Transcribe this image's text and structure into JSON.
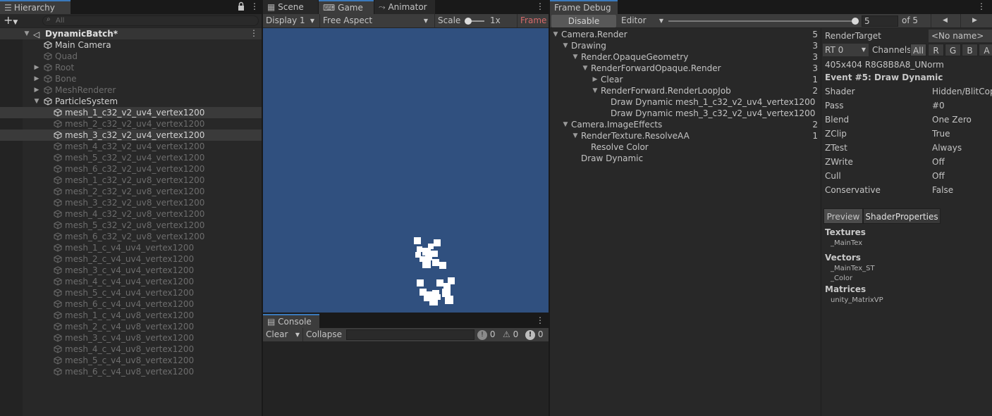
{
  "hierarchy": {
    "tab_label": "Hierarchy",
    "search_placeholder": "All",
    "scene_name": "DynamicBatch*",
    "items": [
      {
        "label": "Main Camera",
        "active": true
      },
      {
        "label": "Quad",
        "active": false
      },
      {
        "label": "Root",
        "active": false
      },
      {
        "label": "Bone",
        "active": false
      },
      {
        "label": "MeshRenderer",
        "active": false
      },
      {
        "label": "ParticleSystem",
        "active": true
      }
    ],
    "children": [
      {
        "label": "mesh_1_c32_v2_uv4_vertex1200",
        "active": true
      },
      {
        "label": "mesh_2_c32_v2_uv4_vertex1200",
        "active": false
      },
      {
        "label": "mesh_3_c32_v2_uv4_vertex1200",
        "active": true
      },
      {
        "label": "mesh_4_c32_v2_uv4_vertex1200",
        "active": false
      },
      {
        "label": "mesh_5_c32_v2_uv4_vertex1200",
        "active": false
      },
      {
        "label": "mesh_6_c32_v2_uv4_vertex1200",
        "active": false
      },
      {
        "label": "mesh_1_c32_v2_uv8_vertex1200",
        "active": false
      },
      {
        "label": "mesh_2_c32_v2_uv8_vertex1200",
        "active": false
      },
      {
        "label": "mesh_3_c32_v2_uv8_vertex1200",
        "active": false
      },
      {
        "label": "mesh_4_c32_v2_uv8_vertex1200",
        "active": false
      },
      {
        "label": "mesh_5_c32_v2_uv8_vertex1200",
        "active": false
      },
      {
        "label": "mesh_6_c32_v2_uv8_vertex1200",
        "active": false
      },
      {
        "label": "mesh_1_c_v4_uv4_vertex1200",
        "active": false
      },
      {
        "label": "mesh_2_c_v4_uv4_vertex1200",
        "active": false
      },
      {
        "label": "mesh_3_c_v4_uv4_vertex1200",
        "active": false
      },
      {
        "label": "mesh_4_c_v4_uv4_vertex1200",
        "active": false
      },
      {
        "label": "mesh_5_c_v4_uv4_vertex1200",
        "active": false
      },
      {
        "label": "mesh_6_c_v4_uv4_vertex1200",
        "active": false
      },
      {
        "label": "mesh_1_c_v4_uv8_vertex1200",
        "active": false
      },
      {
        "label": "mesh_2_c_v4_uv8_vertex1200",
        "active": false
      },
      {
        "label": "mesh_3_c_v4_uv8_vertex1200",
        "active": false
      },
      {
        "label": "mesh_4_c_v4_uv8_vertex1200",
        "active": false
      },
      {
        "label": "mesh_5_c_v4_uv8_vertex1200",
        "active": false
      },
      {
        "label": "mesh_6_c_v4_uv8_vertex1200",
        "active": false
      }
    ]
  },
  "game": {
    "tabs": {
      "scene": "Scene",
      "game": "Game",
      "animator": "Animator"
    },
    "display": "Display 1",
    "aspect": "Free Aspect",
    "scale_label": "Scale",
    "scale_value": "1x",
    "frame_label": "Frame I",
    "viewport_color": "#30507f"
  },
  "console": {
    "tab_label": "Console",
    "clear": "Clear",
    "collapse": "Collapse",
    "info_count": "0",
    "warn_count": "0",
    "error_count": "0"
  },
  "frame_debug": {
    "tab_label": "Frame Debug",
    "disable": "Disable",
    "target": "Editor",
    "frame_value": "5",
    "frame_total": "of 5",
    "slider_fraction": 1.0,
    "tree": [
      {
        "label": "Camera.Render",
        "count": "5",
        "arrow": "down"
      },
      {
        "label": "Drawing",
        "count": "3",
        "arrow": "down"
      },
      {
        "label": "Render.OpaqueGeometry",
        "count": "3",
        "arrow": "down"
      },
      {
        "label": "RenderForwardOpaque.Render",
        "count": "3",
        "arrow": "down"
      },
      {
        "label": "Clear",
        "count": "1",
        "arrow": "right"
      },
      {
        "label": "RenderForward.RenderLoopJob",
        "count": "2",
        "arrow": "down"
      },
      {
        "label": "Draw Dynamic mesh_1_c32_v2_uv4_vertex1200",
        "count": "",
        "arrow": ""
      },
      {
        "label": "Draw Dynamic mesh_3_c32_v2_uv4_vertex1200",
        "count": "",
        "arrow": ""
      },
      {
        "label": "Camera.ImageEffects",
        "count": "2",
        "arrow": "down"
      },
      {
        "label": "RenderTexture.ResolveAA",
        "count": "1",
        "arrow": "down"
      },
      {
        "label": "Resolve Color",
        "count": "",
        "arrow": ""
      },
      {
        "label": "Draw Dynamic",
        "count": "",
        "arrow": ""
      }
    ],
    "details": {
      "render_target_label": "RenderTarget",
      "render_target_value": "<No name>",
      "rt": "RT 0",
      "channels_label": "Channels",
      "channels": [
        "All",
        "R",
        "G",
        "B",
        "A"
      ],
      "format": "405x404 R8G8B8A8_UNorm",
      "event_title": "Event #5: Draw Dynamic",
      "props": [
        {
          "name": "Shader",
          "value": "Hidden/BlitCop"
        },
        {
          "name": "Pass",
          "value": "#0"
        },
        {
          "name": "Blend",
          "value": "One Zero"
        },
        {
          "name": "ZClip",
          "value": "True"
        },
        {
          "name": "ZTest",
          "value": "Always"
        },
        {
          "name": "ZWrite",
          "value": "Off"
        },
        {
          "name": "Cull",
          "value": "Off"
        },
        {
          "name": "Conservative",
          "value": "False"
        }
      ],
      "preview_tab": "Preview",
      "shaderprops_tab": "ShaderProperties",
      "textures_header": "Textures",
      "textures": [
        "_MainTex"
      ],
      "vectors_header": "Vectors",
      "vectors": [
        "_MainTex_ST",
        "_Color"
      ],
      "matrices_header": "Matrices",
      "matrices": [
        "unity_MatrixVP"
      ]
    }
  }
}
